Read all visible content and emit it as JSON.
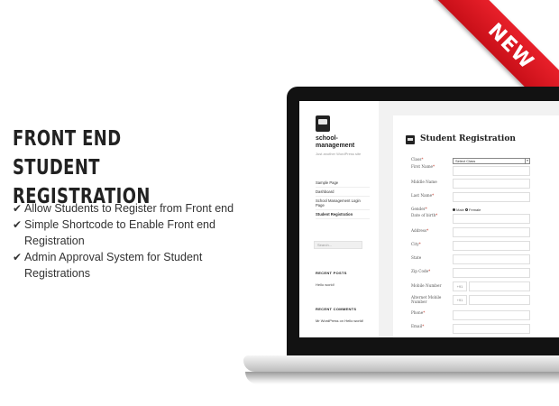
{
  "promo": {
    "headline_line1": "FRONT END STUDENT",
    "headline_line2": "REGISTRATION",
    "features": [
      "Allow Students to Register from Front end",
      "Simple Shortcode to Enable Front end Registration",
      "Admin Approval System for Student Registrations"
    ],
    "check_glyph": "✔"
  },
  "ribbon": {
    "label": "NEW",
    "color": "#d8161f"
  },
  "site": {
    "title": "school-management",
    "tagline": "Just another WordPress site",
    "nav": [
      "Sample Page",
      "Dashboard",
      "School Management Login Page",
      "Student Registration"
    ],
    "search_placeholder": "Search...",
    "recent_posts_heading": "RECENT POSTS",
    "recent_post": "Hello world!",
    "recent_comments_heading": "RECENT COMMENTS",
    "recent_comment_author": "Mr WordPress",
    "recent_comment_on": "on",
    "recent_comment_post": "Hello world!"
  },
  "form": {
    "title": "Student Registration",
    "fields": {
      "class": "Class",
      "first_name": "First Name",
      "middle_name": "Middle Name",
      "last_name": "Last Name",
      "gender": "Gender",
      "dob": "Date of birth",
      "address": "Address",
      "city": "City",
      "state": "State",
      "zip": "Zip Code",
      "mobile": "Mobile Number",
      "alt_mobile_1": "Alternet Mobile",
      "alt_mobile_2": "Number",
      "phone": "Phone",
      "email": "Email"
    },
    "class_select_value": "Select Class",
    "gender_male": "Male",
    "gender_female": "Female",
    "phone_prefix": "+91",
    "required_mark": "*"
  }
}
